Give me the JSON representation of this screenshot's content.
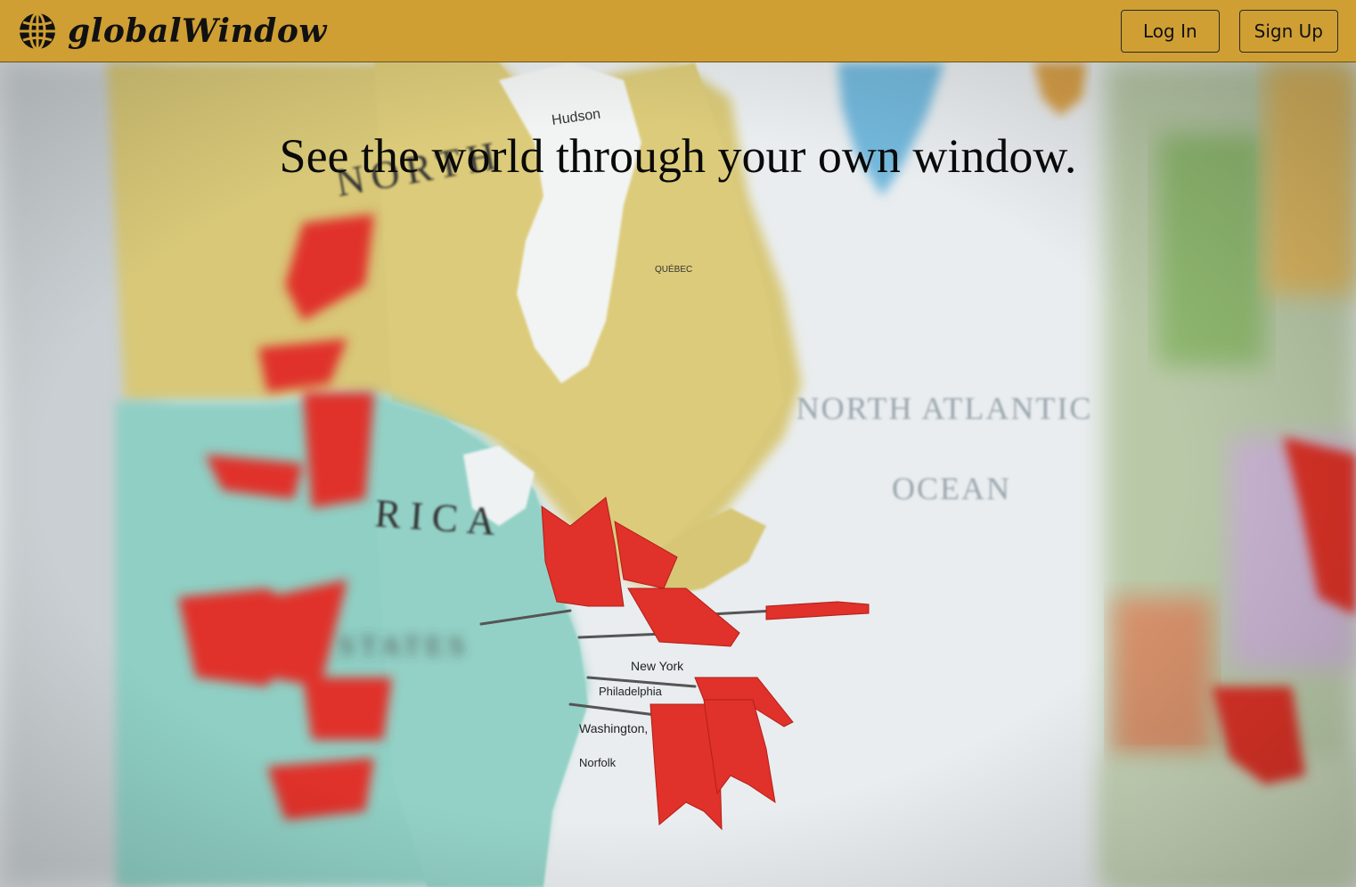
{
  "header": {
    "brand_name": "globalWindow",
    "brand_icon": "globe-icon",
    "background_color": "#CF9F33",
    "login_label": "Log In",
    "signup_label": "Sign Up"
  },
  "hero": {
    "headline": "See the world through your own window.",
    "background_image": "world-map-with-red-flag-pins",
    "map_labels": [
      "Hudson",
      "NORTH",
      "RICA",
      "STATES",
      "New York",
      "Philadelphia",
      "Washington, D.C.",
      "Norfolk",
      "QUÉBEC",
      "NORTH ATLANTIC",
      "OCEAN"
    ]
  },
  "colors": {
    "header_bg": "#CF9F33",
    "land_yellow": "#D8C878",
    "land_teal": "#8FCFC4",
    "ocean": "#EEF1F2",
    "pin_red": "#E0312A"
  }
}
